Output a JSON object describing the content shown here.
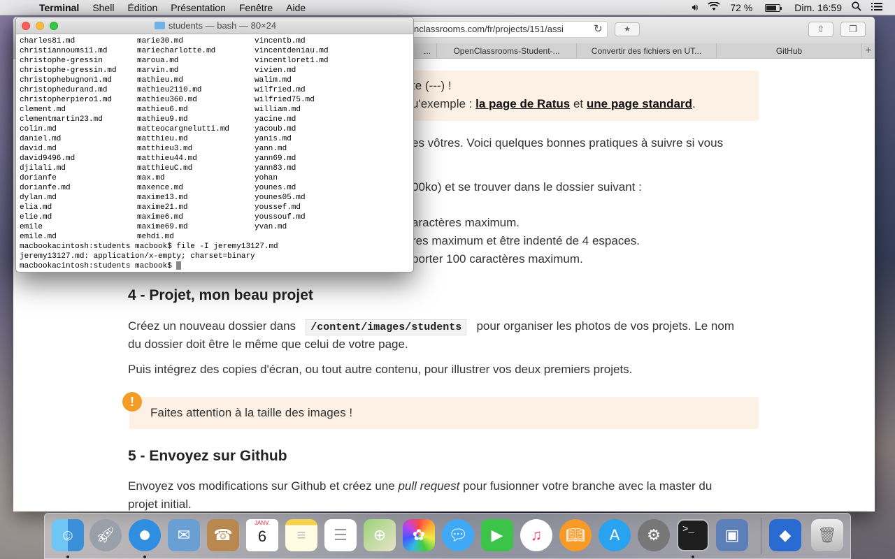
{
  "menubar": {
    "apple": "",
    "app_name": "Terminal",
    "items": [
      "Shell",
      "Édition",
      "Présentation",
      "Fenêtre",
      "Aide"
    ],
    "battery_percent": "72 %",
    "clock": "Dim. 16:59"
  },
  "safari": {
    "url_visible": "nclassrooms.com/fr/projects/151/assi",
    "tabs": [
      "...",
      "OpenClassrooms-Student-...",
      "Convertir des fichiers en UT...",
      "GitHub"
    ],
    "add_tab_label": "+",
    "notice_line1": "te (---) !",
    "notice_line2_prefix": "u'exemple : ",
    "notice_link1": "la page de Ratus",
    "notice_and": " et ",
    "notice_link2": "une page standard",
    "notice_end": ".",
    "para1": "es vôtres. Voici quelques bonnes pratiques à suivre si vous",
    "para2": "00ko) et se trouver dans le dossier suivant :",
    "bullet1": "aractères maximum.",
    "bullet2": "res maximum et être indenté de 4 espaces.",
    "bullet3": "porter 100 caractères maximum.",
    "h4": "4 - Projet, mon beau projet",
    "p4a_pre": "Créez un nouveau dossier dans",
    "p4a_code": "/content/images/students",
    "p4a_post": "pour organiser les photos de vos projets. Le nom",
    "p4b": "du dossier doit être le même que celui de votre page.",
    "p4c": "Puis intégrez des copies d'écran, ou tout autre contenu, pour illustrer vos deux premiers projets.",
    "warn_icon": "!",
    "warning": "Faites attention à la taille des images !",
    "h5": "5 - Envoyez sur Github",
    "p5a_pre": "Envoyez vos modifications sur Github et créez une ",
    "p5a_em": "pull request",
    "p5a_post": " pour fusionner votre branche avec la master du",
    "p5b": "projet initial."
  },
  "terminal": {
    "title": "students — bash — 80×24",
    "col1": [
      "charles81.md",
      "christiannoumsi1.md",
      "christophe-gressin",
      "christophe-gressin.md",
      "christophebugnon1.md",
      "christophedurand.md",
      "christopherpiero1.md",
      "clement.md",
      "clementmartin23.md",
      "colin.md",
      "daniel.md",
      "david.md",
      "david9496.md",
      "djilali.md",
      "dorianfe",
      "dorianfe.md",
      "dylan.md",
      "elia.md",
      "elie.md",
      "emile",
      "emile.md"
    ],
    "col2": [
      "marie30.md",
      "mariecharlotte.md",
      "maroua.md",
      "marvin.md",
      "mathieu.md",
      "mathieu2110.md",
      "mathieu360.md",
      "mathieu6.md",
      "mathieu9.md",
      "matteocargnelutti.md",
      "matthieu.md",
      "matthieu3.md",
      "matthieu44.md",
      "matthieuC.md",
      "max.md",
      "maxence.md",
      "maxime13.md",
      "maxime21.md",
      "maxime6.md",
      "maxime69.md",
      "mehdi.md"
    ],
    "col3": [
      "vincentb.md",
      "vincentdeniau.md",
      "vincentloret1.md",
      "vivien.md",
      "walim.md",
      "wilfried.md",
      "wilfried75.md",
      "william.md",
      "yacine.md",
      "yacoub.md",
      "yanis.md",
      "yann.md",
      "yann69.md",
      "yann83.md",
      "yohan",
      "younes.md",
      "younes05.md",
      "youssef.md",
      "youssouf.md",
      "yvan.md",
      ""
    ],
    "cmd_line": "macbookacintosh:students macbook$ file -I jeremy13127.md",
    "output_line": "jeremy13127.md: application/x-empty; charset=binary",
    "prompt": "macbookacintosh:students macbook$ "
  },
  "dock": {
    "calendar_month": "JANV.",
    "calendar_day": "6",
    "apps": [
      "Finder",
      "Launchpad",
      "Safari",
      "Mail",
      "Contacts",
      "Calendrier",
      "Notes",
      "Rappels",
      "Plans",
      "Photos",
      "Messages",
      "FaceTime",
      "iTunes",
      "iBooks",
      "App Store",
      "Préférences Système",
      "Terminal",
      "VirtualBox",
      "VirtualBox VM",
      "Corbeille"
    ]
  },
  "colors": {
    "notice_bg": "#fdf0e4",
    "warn_icon": "#f39c26",
    "terminal_title": "#d3d3d3"
  }
}
